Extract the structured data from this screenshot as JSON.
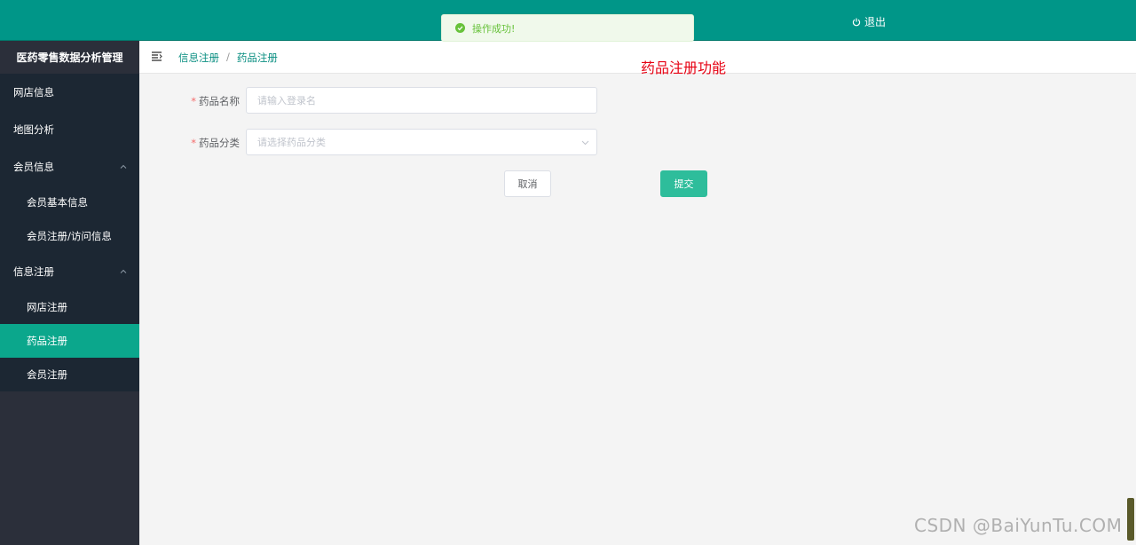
{
  "header": {
    "logout_label": "退出"
  },
  "toast": {
    "message": "操作成功!"
  },
  "sidebar": {
    "title": "医药零售数据分析管理",
    "items": [
      {
        "label": "网店信息"
      },
      {
        "label": "地图分析"
      },
      {
        "label": "会员信息",
        "children": [
          "会员基本信息",
          "会员注册/访问信息"
        ]
      },
      {
        "label": "信息注册",
        "children": [
          "网店注册",
          "药品注册",
          "会员注册"
        ]
      }
    ],
    "active": "药品注册"
  },
  "breadcrumb": [
    "信息注册",
    "药品注册"
  ],
  "page_note": "药品注册功能",
  "form": {
    "name_label": "药品名称",
    "name_placeholder": "请输入登录名",
    "category_label": "药品分类",
    "category_placeholder": "请选择药品分类",
    "cancel_label": "取消",
    "submit_label": "提交"
  },
  "watermark": "CSDN @BaiYunTu.COM",
  "colors": {
    "accent": "#009688",
    "active_menu": "#0ba78c",
    "submit": "#2ebd9b",
    "note": "#e60012"
  }
}
